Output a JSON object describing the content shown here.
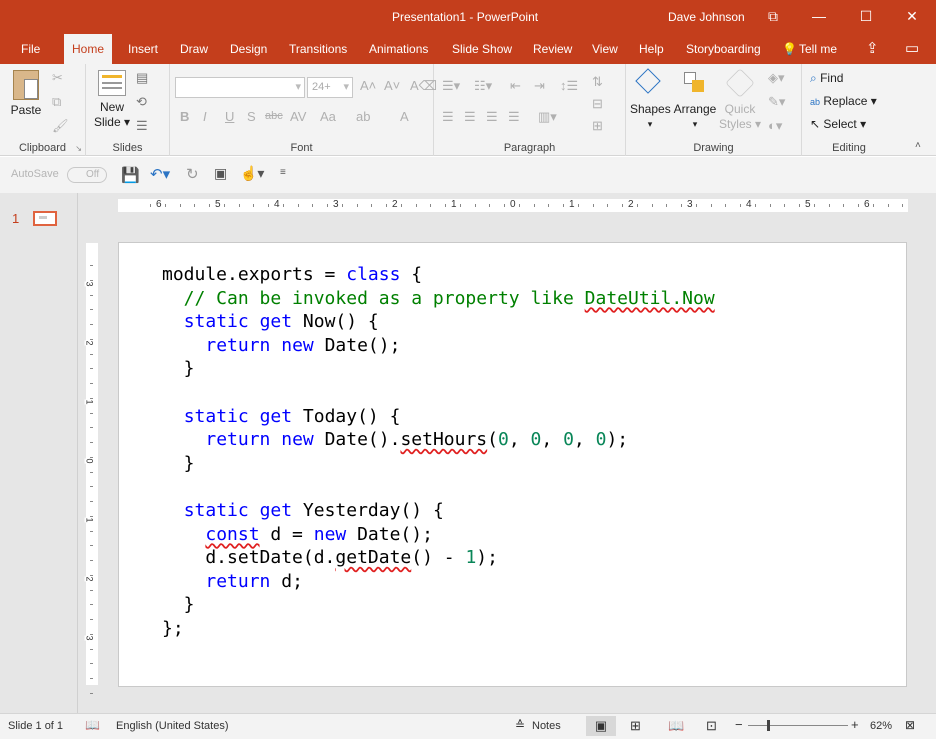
{
  "window": {
    "title": "Presentation1  -  PowerPoint",
    "user": "Dave Johnson",
    "restore_glyph": "⧉",
    "min_glyph": "—",
    "max_glyph": "☐",
    "close_glyph": "✕"
  },
  "tabs": [
    {
      "label": "File"
    },
    {
      "label": "Home"
    },
    {
      "label": "Insert"
    },
    {
      "label": "Draw"
    },
    {
      "label": "Design"
    },
    {
      "label": "Transitions"
    },
    {
      "label": "Animations"
    },
    {
      "label": "Slide Show"
    },
    {
      "label": "Review"
    },
    {
      "label": "View"
    },
    {
      "label": "Help"
    },
    {
      "label": "Storyboarding"
    },
    {
      "label": "Tell me"
    }
  ],
  "ribbon": {
    "clipboard": {
      "paste": "Paste",
      "label": "Clipboard"
    },
    "slides": {
      "new_slide_1": "New",
      "new_slide_2": "Slide ▾",
      "label": "Slides"
    },
    "font": {
      "size": "24+",
      "label": "Font",
      "bold": "B",
      "italic": "I",
      "underline": "U",
      "shadow": "S",
      "strike": "abc",
      "spacing": "AV",
      "case": "Aa",
      "color": "A"
    },
    "paragraph": {
      "label": "Paragraph"
    },
    "drawing": {
      "shapes": "Shapes",
      "arrange": "Arrange",
      "quick_styles_1": "Quick",
      "quick_styles_2": "Styles ▾",
      "label": "Drawing"
    },
    "editing": {
      "find": "Find",
      "replace": "Replace",
      "select": "Select",
      "label": "Editing"
    }
  },
  "qat": {
    "autosave": "AutoSave",
    "toggle": "Off"
  },
  "thumbs": {
    "slide_number": "1"
  },
  "rulers": {
    "h_ticks": [
      "6",
      "5",
      "4",
      "3",
      "2",
      "1",
      "0",
      "1",
      "2",
      "3",
      "4",
      "5",
      "6"
    ],
    "v_ticks": [
      "3",
      "2",
      "1",
      "0",
      "1",
      "2",
      "3"
    ]
  },
  "code": {
    "l1a": "module.exports = ",
    "l1b": "class",
    "l1c": " {",
    "l2a": "  // Can be invoked as a property like ",
    "l2b": "DateUtil.Now",
    "l3a": "  ",
    "l3b": "static",
    "l3c": " ",
    "l3d": "get",
    "l3e": " Now() {",
    "l4a": "    ",
    "l4b": "return",
    "l4c": " ",
    "l4d": "new",
    "l4e": " Date();",
    "l5": "  }",
    "l7a": "  ",
    "l7b": "static",
    "l7c": " ",
    "l7d": "get",
    "l7e": " Today() {",
    "l8a": "    ",
    "l8b": "return",
    "l8c": " ",
    "l8d": "new",
    "l8e": " Date().",
    "l8f": "setHours",
    "l8g": "(",
    "l8h": "0",
    "l8i": ", ",
    "l8j": "0",
    "l8k": ", ",
    "l8l": "0",
    "l8m": ", ",
    "l8n": "0",
    "l8o": ");",
    "l9": "  }",
    "l11a": "  ",
    "l11b": "static",
    "l11c": " ",
    "l11d": "get",
    "l11e": " Yesterday() {",
    "l12a": "    ",
    "l12b": "const",
    "l12c": " d = ",
    "l12d": "new",
    "l12e": " Date();",
    "l13a": "    d.setDate(d.",
    "l13b": "getDate",
    "l13c": "() - ",
    "l13d": "1",
    "l13e": ");",
    "l14a": "    ",
    "l14b": "return",
    "l14c": " d;",
    "l15": "  }",
    "l16": "};"
  },
  "status": {
    "slide": "Slide 1 of 1",
    "language": "English (United States)",
    "notes": "Notes",
    "zoom": "62%",
    "zoom_level_percent": 62
  }
}
